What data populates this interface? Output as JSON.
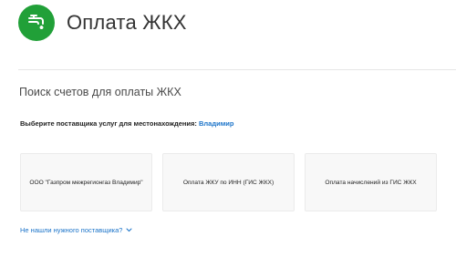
{
  "header": {
    "title": "Оплата ЖКХ",
    "icon": "water-tap-icon"
  },
  "search": {
    "title": "Поиск счетов для оплаты ЖКХ",
    "location_prompt": "Выберите поставщика услуг для местонахождения:",
    "location_city": "Владимир"
  },
  "providers": [
    {
      "label": "ООО \"Газпром межрегионгаз Владимир\""
    },
    {
      "label": "Оплата ЖКУ по ИНН (ГИС ЖКХ)"
    },
    {
      "label": "Оплата начислений из ГИС ЖКХ"
    }
  ],
  "footer_link": {
    "label": "Не нашли нужного поставщика?"
  },
  "colors": {
    "brand": "#21a038",
    "link": "#1a73c9"
  }
}
